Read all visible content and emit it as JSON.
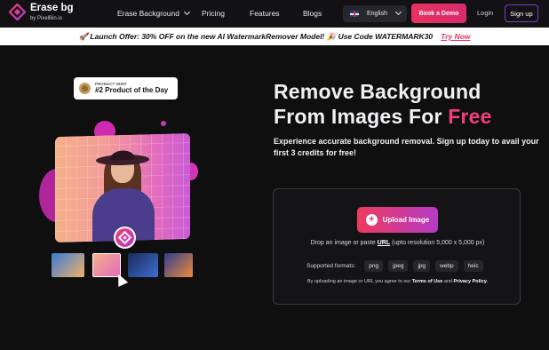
{
  "nav": {
    "brand_name": "Erase bg",
    "brand_by": "by PixelBin.io",
    "links": [
      "Erase Background",
      "Pricing",
      "Features",
      "Blogs"
    ],
    "language": "English",
    "demo_label": "Book a Demo",
    "login_label": "Login",
    "signup_label": "Sign up"
  },
  "promo": {
    "text": "🚀 Launch Offer: 30% OFF on the new AI WatermarkRemover Model! 🎉 Use Code WATERMARK30",
    "cta": "Try Now"
  },
  "badge": {
    "small": "PRODUCT HUNT",
    "big": "#2 Product of the Day"
  },
  "hero": {
    "headline_line1": "Remove Background",
    "headline_line2": "From Images For ",
    "headline_highlight": "Free",
    "subtext": "Experience accurate background removal. Sign up today to avail your first 3 credits for free!"
  },
  "upload": {
    "button_label": "Upload Image",
    "drop_prefix": "Drop an image or paste ",
    "drop_url": "URL",
    "drop_suffix": " (upto resolution 5,000 x 5,000 px)",
    "formats_label": "Supported formats:",
    "formats": [
      "png",
      "jpeg",
      "jpg",
      "webp",
      "heic"
    ],
    "agree_prefix": "By uploading an image or URL you agree to our ",
    "terms": "Terms of Use",
    "and": " and ",
    "privacy": "Privacy Policy."
  },
  "colors": {
    "accent": "#e8315f",
    "purple": "#b43ac6",
    "background": "#0f0f10"
  }
}
